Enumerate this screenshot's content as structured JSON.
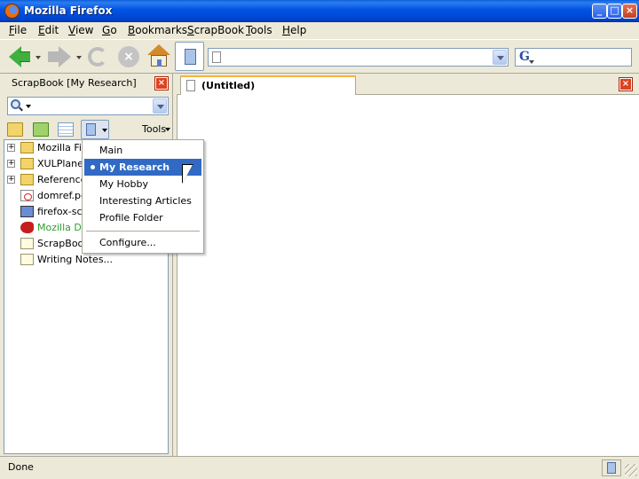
{
  "window": {
    "title": "Mozilla Firefox",
    "controls": [
      "minimize",
      "maximize",
      "close"
    ]
  },
  "menubar": {
    "items": [
      "File",
      "Edit",
      "View",
      "Go",
      "Bookmarks",
      "ScrapBook",
      "Tools",
      "Help"
    ]
  },
  "toolbar": {
    "icons": [
      "back-icon",
      "forward-icon",
      "reload-icon",
      "stop-icon",
      "home-icon",
      "sidebar-toggle-icon"
    ],
    "url_value": "",
    "search_value": "",
    "search_engine": "Google"
  },
  "sidebar": {
    "title": "ScrapBook [My Research]",
    "search_value": "",
    "tools_label": "Tools",
    "tree": [
      {
        "label": "Mozilla Firefox",
        "icon": "folder-icon",
        "expandable": true,
        "color": "#000000"
      },
      {
        "label": "XULPlanet",
        "icon": "folder-icon",
        "expandable": true,
        "color": "#000000"
      },
      {
        "label": "Reference",
        "icon": "folder-icon",
        "expandable": true,
        "color": "#000000"
      },
      {
        "label": "domref.pdf",
        "icon": "pdf-icon",
        "expandable": false,
        "color": "#000000"
      },
      {
        "label": "firefox-scr",
        "icon": "image-icon",
        "expandable": false,
        "color": "#000000"
      },
      {
        "label": "Mozilla Dev",
        "icon": "mozilla-dino-icon",
        "expandable": false,
        "color": "#2e9e2e"
      },
      {
        "label": "ScrapBook",
        "icon": "page-icon",
        "expandable": false,
        "color": "#000000"
      },
      {
        "label": "Writing Notes...",
        "icon": "page-icon",
        "expandable": false,
        "color": "#000000"
      }
    ]
  },
  "popup_menu": {
    "items": [
      {
        "label": "Main",
        "selected": false
      },
      {
        "label": "My Research",
        "selected": true
      },
      {
        "label": "My Hobby",
        "selected": false
      },
      {
        "label": "Interesting Articles",
        "selected": false
      },
      {
        "label": "Profile Folder",
        "selected": false
      }
    ],
    "footer_item": "Configure..."
  },
  "tabs": [
    {
      "label": "(Untitled)",
      "active": true
    }
  ],
  "statusbar": {
    "text": "Done"
  },
  "colors": {
    "titlebar": "#0054e3",
    "selection": "#316ac5",
    "tab_accent": "#f6b543",
    "close_button": "#e0401e"
  }
}
